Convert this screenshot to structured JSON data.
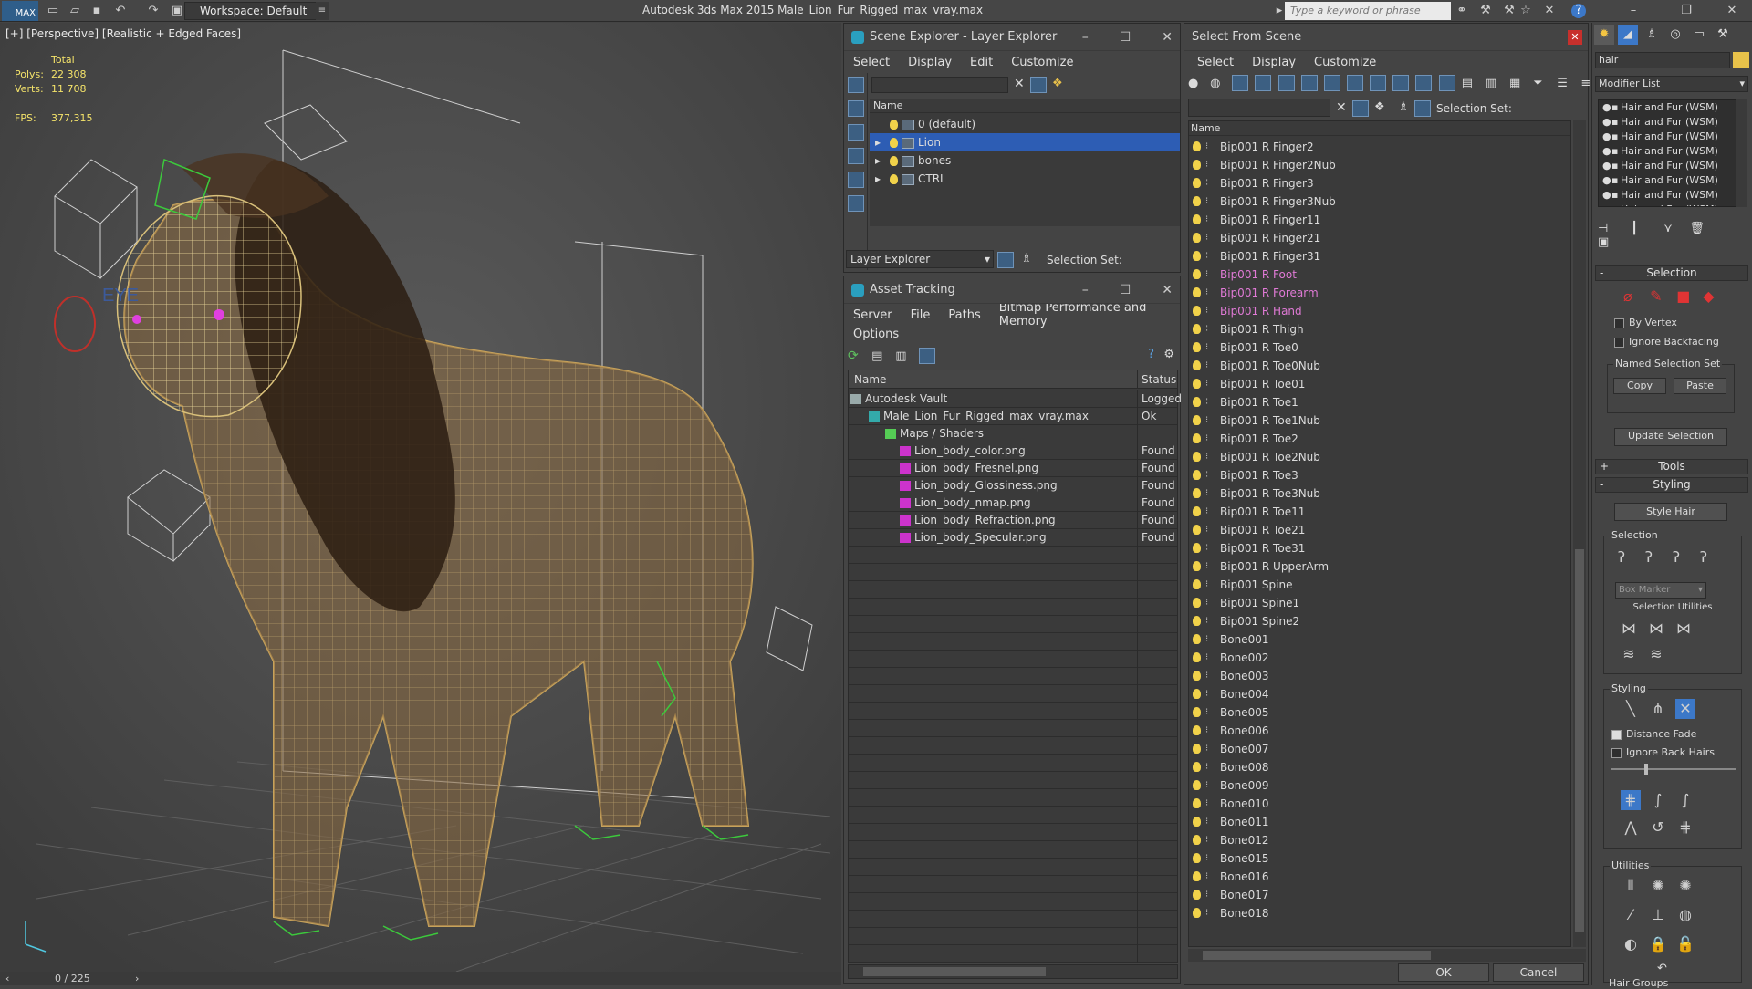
{
  "titlebar": {
    "logo": "MAX",
    "workspace": "Workspace: Default",
    "app_title": "Autodesk 3ds Max  2015     Male_Lion_Fur_Rigged_max_vray.max",
    "search_placeholder": "Type a keyword or phrase"
  },
  "viewport": {
    "label": "[+] [Perspective] [Realistic + Edged Faces]",
    "stats": {
      "total_label": "Total",
      "polys_label": "Polys:",
      "polys": "22 308",
      "verts_label": "Verts:",
      "verts": "11 708",
      "fps_label": "FPS:",
      "fps": "377,315"
    },
    "eye_label": "EYE",
    "timeline": "0 / 225"
  },
  "scene_explorer": {
    "title": "Scene Explorer - Layer Explorer",
    "menu": [
      "Select",
      "Display",
      "Edit",
      "Customize"
    ],
    "col_name": "Name",
    "layers": [
      "0 (default)",
      "Lion",
      "bones",
      "CTRL"
    ],
    "footer_dropdown": "Layer Explorer",
    "selection_set": "Selection Set:"
  },
  "asset_tracking": {
    "title": "Asset Tracking",
    "menu": [
      "Server",
      "File",
      "Paths",
      "Bitmap Performance and Memory"
    ],
    "menu2": "Options",
    "col_name": "Name",
    "col_status": "Status",
    "rows": [
      {
        "name": "Autodesk Vault",
        "status": "Logged"
      },
      {
        "name": "Male_Lion_Fur_Rigged_max_vray.max",
        "status": "Ok"
      },
      {
        "name": "Maps / Shaders",
        "status": ""
      },
      {
        "name": "Lion_body_color.png",
        "status": "Found"
      },
      {
        "name": "Lion_body_Fresnel.png",
        "status": "Found"
      },
      {
        "name": "Lion_body_Glossiness.png",
        "status": "Found"
      },
      {
        "name": "Lion_body_nmap.png",
        "status": "Found"
      },
      {
        "name": "Lion_body_Refraction.png",
        "status": "Found"
      },
      {
        "name": "Lion_body_Specular.png",
        "status": "Found"
      }
    ]
  },
  "select_from_scene": {
    "title": "Select From Scene",
    "menu": [
      "Select",
      "Display",
      "Customize"
    ],
    "selection_set": "Selection Set:",
    "col_name": "Name",
    "items": [
      {
        "n": "Bip001 R Finger2",
        "p": false
      },
      {
        "n": "Bip001 R Finger2Nub",
        "p": false
      },
      {
        "n": "Bip001 R Finger3",
        "p": false
      },
      {
        "n": "Bip001 R Finger3Nub",
        "p": false
      },
      {
        "n": "Bip001 R Finger11",
        "p": false
      },
      {
        "n": "Bip001 R Finger21",
        "p": false
      },
      {
        "n": "Bip001 R Finger31",
        "p": false
      },
      {
        "n": "Bip001 R Foot",
        "p": true
      },
      {
        "n": "Bip001 R Forearm",
        "p": true
      },
      {
        "n": "Bip001 R Hand",
        "p": true
      },
      {
        "n": "Bip001 R Thigh",
        "p": false
      },
      {
        "n": "Bip001 R Toe0",
        "p": false
      },
      {
        "n": "Bip001 R Toe0Nub",
        "p": false
      },
      {
        "n": "Bip001 R Toe01",
        "p": false
      },
      {
        "n": "Bip001 R Toe1",
        "p": false
      },
      {
        "n": "Bip001 R Toe1Nub",
        "p": false
      },
      {
        "n": "Bip001 R Toe2",
        "p": false
      },
      {
        "n": "Bip001 R Toe2Nub",
        "p": false
      },
      {
        "n": "Bip001 R Toe3",
        "p": false
      },
      {
        "n": "Bip001 R Toe3Nub",
        "p": false
      },
      {
        "n": "Bip001 R Toe11",
        "p": false
      },
      {
        "n": "Bip001 R Toe21",
        "p": false
      },
      {
        "n": "Bip001 R Toe31",
        "p": false
      },
      {
        "n": "Bip001 R UpperArm",
        "p": false
      },
      {
        "n": "Bip001 Spine",
        "p": false
      },
      {
        "n": "Bip001 Spine1",
        "p": false
      },
      {
        "n": "Bip001 Spine2",
        "p": false
      },
      {
        "n": "Bone001",
        "p": false
      },
      {
        "n": "Bone002",
        "p": false
      },
      {
        "n": "Bone003",
        "p": false
      },
      {
        "n": "Bone004",
        "p": false
      },
      {
        "n": "Bone005",
        "p": false
      },
      {
        "n": "Bone006",
        "p": false
      },
      {
        "n": "Bone007",
        "p": false
      },
      {
        "n": "Bone008",
        "p": false
      },
      {
        "n": "Bone009",
        "p": false
      },
      {
        "n": "Bone010",
        "p": false
      },
      {
        "n": "Bone011",
        "p": false
      },
      {
        "n": "Bone012",
        "p": false
      },
      {
        "n": "Bone015",
        "p": false
      },
      {
        "n": "Bone016",
        "p": false
      },
      {
        "n": "Bone017",
        "p": false
      },
      {
        "n": "Bone018",
        "p": false
      }
    ],
    "ok": "OK",
    "cancel": "Cancel",
    "highlight_color": "#e07ad6"
  },
  "command_panel": {
    "object_name": "hair",
    "modifier_list": "Modifier List",
    "stack": [
      "Hair and Fur (WSM)",
      "Hair and Fur (WSM)",
      "Hair and Fur (WSM)",
      "Hair and Fur (WSM)",
      "Hair and Fur (WSM)",
      "Hair and Fur (WSM)",
      "Hair and Fur (WSM)",
      "Hair and Fur (WSM)"
    ],
    "selection_header": "Selection",
    "by_vertex": "By Vertex",
    "ignore_backfacing": "Ignore Backfacing",
    "named_selection_set": "Named Selection Set",
    "copy": "Copy",
    "paste": "Paste",
    "update_selection": "Update Selection",
    "tools_header": "Tools",
    "styling_header": "Styling",
    "style_hair": "Style Hair",
    "selection_group": "Selection",
    "box_marker": "Box Marker",
    "selection_utilities": "Selection Utilities",
    "styling_group": "Styling",
    "distance_fade": "Distance Fade",
    "ignore_back_hairs": "Ignore Back Hairs",
    "utilities_group": "Utilities",
    "hair_groups": "Hair Groups"
  },
  "colors": {
    "selected_row": "#2d5db4",
    "accent_blue": "#3c78c8",
    "panel_bg": "#444444",
    "bulb": "#f1d24a"
  }
}
